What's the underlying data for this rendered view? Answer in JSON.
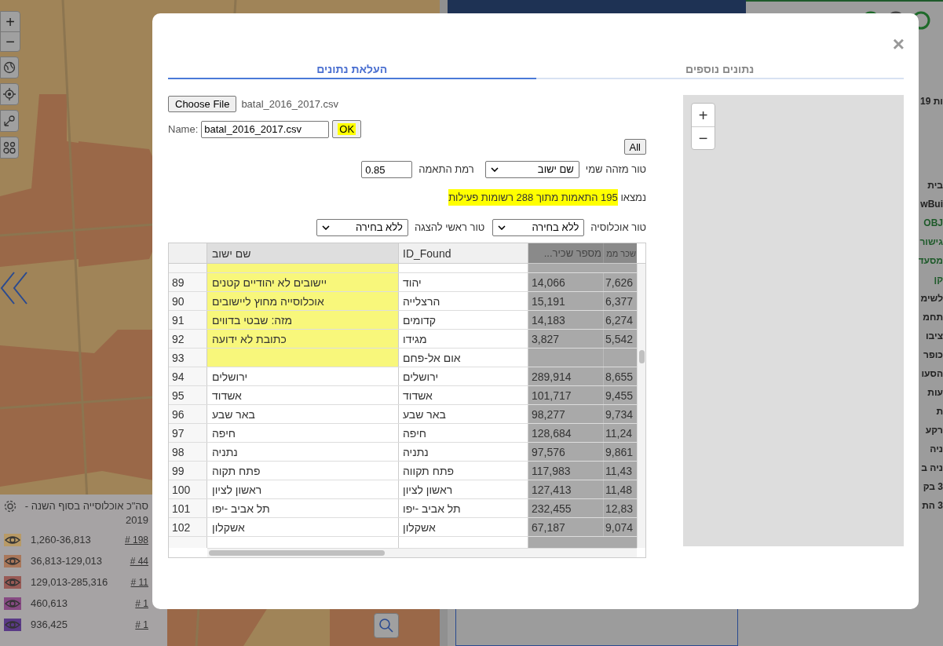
{
  "map": {
    "zoom_in": "+",
    "zoom_out": "−"
  },
  "legend": {
    "title": "סה\"כ אוכלוסייה בסוף השנה - 2019",
    "items": [
      {
        "range": "1,260-36,813",
        "count": "# 198",
        "color": "#b89a66"
      },
      {
        "range": "36,813-129,013",
        "count": "# 44",
        "color": "#a9775a"
      },
      {
        "range": "129,013-285,316",
        "count": "# 11",
        "color": "#985a55"
      },
      {
        "range": "460,613",
        "count": "# 1",
        "color": "#864a82"
      },
      {
        "range": "936,425",
        "count": "# 1",
        "color": "#5a3a86"
      }
    ]
  },
  "side_panel": {
    "lines": [
      {
        "text": "ות 19",
        "kind": "heading"
      },
      {
        "text": "בית",
        "kind": "plain"
      },
      {
        "text": "wBui",
        "kind": "plain"
      },
      {
        "text": "OBJ",
        "kind": "green"
      },
      {
        "text": "גישור",
        "kind": "green"
      },
      {
        "text": "מסעד",
        "kind": "green"
      },
      {
        "text": "קן",
        "kind": "green"
      },
      {
        "text": "לשימ",
        "kind": "plain"
      },
      {
        "text": "תחמ",
        "kind": "plain"
      },
      {
        "text": "ציבו",
        "kind": "plain"
      },
      {
        "text": "כופר",
        "kind": "plain"
      },
      {
        "text": "הסעו",
        "kind": "plain"
      },
      {
        "text": "עות",
        "kind": "plain"
      },
      {
        "text": "ת",
        "kind": "plain"
      },
      {
        "text": "רקע",
        "kind": "plain"
      },
      {
        "text": "ניה",
        "kind": "plain"
      },
      {
        "text": "ניה ב",
        "kind": "plain"
      },
      {
        "text": "3 בק",
        "kind": "plain"
      },
      {
        "text": "3 הת",
        "kind": "plain"
      }
    ]
  },
  "dialog": {
    "close": "×",
    "tabs": [
      {
        "label": "נתונים נוספים",
        "selected": false
      },
      {
        "label": "העלאת נתונים",
        "selected": true
      }
    ],
    "file": {
      "button": "Choose File",
      "file_name": "batal_2016_2017.csv"
    },
    "name": {
      "label": "Name:",
      "value": "batal_2016_2017.csv",
      "ok": "OK",
      "ok_highlighted": true
    },
    "all_button": "All",
    "id_column": {
      "label": "טור מזהה שמי",
      "value": "שם ישוב"
    },
    "match_level": {
      "label": "רמת התאמה",
      "value": "0.85"
    },
    "result": {
      "prefix": "נמצאו",
      "text": "195 התאמות מתוך 288 רשומות פעילות",
      "highlighted": true
    },
    "population_column": {
      "label": "טור אוכלוסיה",
      "value": "ללא בחירה"
    },
    "main_column": {
      "label": "טור ראשי להצגה",
      "value": "ללא בחירה"
    },
    "table": {
      "header": {
        "name": "שם ישוב",
        "id_found": "ID_Found",
        "col_3": "מספר שכיר...",
        "col_4": "שכר ממ"
      },
      "rows": [
        {
          "num": "89",
          "name": "יישובים לא יהודיים קטנים",
          "id_found": "יהוד",
          "col_3": "14,066",
          "col_4": "7,626",
          "unmatched": true
        },
        {
          "num": "90",
          "name": "אוכלוסייה מחוץ ליישובים",
          "id_found": "הרצלייה",
          "col_3": "15,191",
          "col_4": "6,377",
          "unmatched": true
        },
        {
          "num": "91",
          "name": "מזה: שבטי בדווים",
          "id_found": "קדומים",
          "col_3": "14,183",
          "col_4": "6,274",
          "unmatched": true
        },
        {
          "num": "92",
          "name": "כתובת לא ידועה",
          "id_found": "מגידו",
          "col_3": "3,827",
          "col_4": "5,542",
          "unmatched": true
        },
        {
          "num": "93",
          "id_found": "אום אל-פחם",
          "unmatched": true
        },
        {
          "num": "94",
          "name": "ירושלים",
          "id_found": "ירושלים",
          "col_3": "289,914",
          "col_4": "8,655",
          "unmatched": false
        },
        {
          "num": "95",
          "name": "אשדוד",
          "id_found": "אשדוד",
          "col_3": "101,717",
          "col_4": "9,455",
          "unmatched": false
        },
        {
          "num": "96",
          "name": "באר שבע",
          "id_found": "באר שבע",
          "col_3": "98,277",
          "col_4": "9,734",
          "unmatched": false
        },
        {
          "num": "97",
          "name": "חיפה",
          "id_found": "חיפה",
          "col_3": "128,684",
          "col_4": "11,24",
          "unmatched": false
        },
        {
          "num": "98",
          "name": "נתניה",
          "id_found": "נתניה",
          "col_3": "97,576",
          "col_4": "9,861",
          "unmatched": false
        },
        {
          "num": "99",
          "name": "פתח תקוה",
          "id_found": "פתח תקווה",
          "col_3": "117,983",
          "col_4": "11,43",
          "unmatched": false
        },
        {
          "num": "100",
          "name": "ראשון לציון",
          "id_found": "ראשון לציון",
          "col_3": "127,413",
          "col_4": "11,48",
          "unmatched": false
        },
        {
          "num": "101",
          "name": "תל אביב -יפו",
          "id_found": "תל אביב -יפו",
          "col_3": "232,455",
          "col_4": "12,83",
          "unmatched": false
        },
        {
          "num": "102",
          "name": "אשקלון",
          "id_found": "אשקלון",
          "col_3": "67,187",
          "col_4": "9,074",
          "unmatched": false
        }
      ]
    },
    "preview_map": {
      "zoom_in": "+",
      "zoom_out": "−"
    }
  }
}
